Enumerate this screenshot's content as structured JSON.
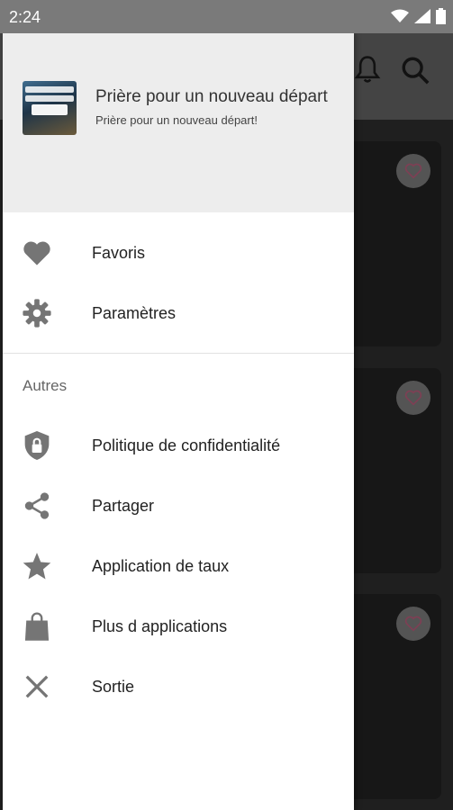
{
  "status_bar": {
    "time": "2:24"
  },
  "drawer": {
    "header": {
      "title": "Prière pour un nouveau départ",
      "subtitle": "Prière pour un nouveau départ!",
      "logo_text": "Prière pour un nouveau départ"
    },
    "primary_items": [
      {
        "label": "Favoris",
        "icon": "heart-icon"
      },
      {
        "label": "Paramètres",
        "icon": "gear-icon"
      }
    ],
    "section_title": "Autres",
    "secondary_items": [
      {
        "label": "Politique de confidentialité",
        "icon": "shield-lock-icon"
      },
      {
        "label": "Partager",
        "icon": "share-icon"
      },
      {
        "label": "Application de taux",
        "icon": "star-icon"
      },
      {
        "label": "Plus d applications",
        "icon": "shopping-bag-icon"
      },
      {
        "label": "Sortie",
        "icon": "close-icon"
      }
    ]
  },
  "colors": {
    "icon_gray": "#757575",
    "header_bg": "#ededed",
    "status_bar_bg": "#7a7a7a",
    "favorite_heart": "#e57399"
  }
}
